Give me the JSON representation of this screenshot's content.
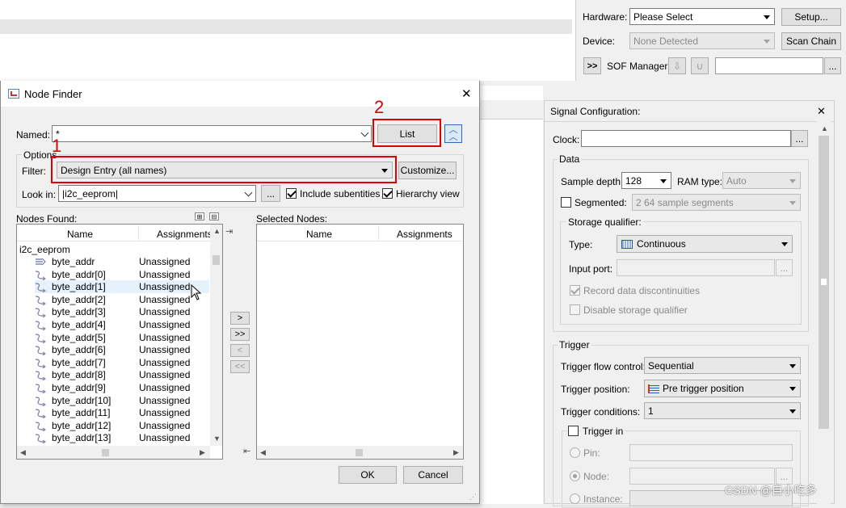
{
  "programmer": {
    "hardware_label": "Hardware:",
    "hardware_value": "Please Select",
    "setup_button": "Setup...",
    "device_label": "Device:",
    "device_value": "None Detected",
    "scan_chain_button": "Scan Chain",
    "expand_button": ">>",
    "sof_manager_label": "SOF Manager:",
    "browse_button": "..."
  },
  "node_finder": {
    "title": "Node Finder",
    "close_glyph": "✕",
    "named_label": "Named:",
    "named_value": "*",
    "list_button": "List",
    "options_label": "Options",
    "filter_label": "Filter:",
    "filter_value": "Design Entry (all names)",
    "customize_button": "Customize...",
    "lookin_label": "Look in:",
    "lookin_value": "|i2c_eeprom|",
    "lookin_browse": "...",
    "include_subentities": "Include subentities",
    "hierarchy_view": "Hierarchy view",
    "nodes_found_label": "Nodes Found:",
    "selected_nodes_label": "Selected Nodes:",
    "col_name": "Name",
    "col_assignments": "Assignments",
    "root_node": "i2c_eeprom",
    "nodes": [
      {
        "name": "byte_addr",
        "assignment": "Unassigned",
        "bus": true
      },
      {
        "name": "byte_addr[0]",
        "assignment": "Unassigned"
      },
      {
        "name": "byte_addr[1]",
        "assignment": "Unassigned",
        "selected": true
      },
      {
        "name": "byte_addr[2]",
        "assignment": "Unassigned"
      },
      {
        "name": "byte_addr[3]",
        "assignment": "Unassigned"
      },
      {
        "name": "byte_addr[4]",
        "assignment": "Unassigned"
      },
      {
        "name": "byte_addr[5]",
        "assignment": "Unassigned"
      },
      {
        "name": "byte_addr[6]",
        "assignment": "Unassigned"
      },
      {
        "name": "byte_addr[7]",
        "assignment": "Unassigned"
      },
      {
        "name": "byte_addr[8]",
        "assignment": "Unassigned"
      },
      {
        "name": "byte_addr[9]",
        "assignment": "Unassigned"
      },
      {
        "name": "byte_addr[10]",
        "assignment": "Unassigned"
      },
      {
        "name": "byte_addr[11]",
        "assignment": "Unassigned"
      },
      {
        "name": "byte_addr[12]",
        "assignment": "Unassigned"
      },
      {
        "name": "byte_addr[13]",
        "assignment": "Unassigned"
      }
    ],
    "move_one": ">",
    "move_all": ">>",
    "remove_one": "<",
    "remove_all": "<<",
    "ok_button": "OK",
    "cancel_button": "Cancel"
  },
  "annotations": {
    "marker_1": "1",
    "marker_2": "2",
    "color": "#e00000"
  },
  "signal_config": {
    "title": "Signal Configuration:",
    "close_glyph": "✕",
    "clock_label": "Clock:",
    "clock_browse": "...",
    "data_group": "Data",
    "sample_depth_label": "Sample depth:",
    "sample_depth_value": "128",
    "ram_type_label": "RAM type:",
    "ram_type_value": "Auto",
    "segmented_label": "Segmented:",
    "segmented_value": "2  64 sample segments",
    "storage_qualifier_group": "Storage qualifier:",
    "type_label": "Type:",
    "type_value": "Continuous",
    "input_port_label": "Input port:",
    "input_port_browse": "...",
    "record_discontinuities": "Record data discontinuities",
    "disable_storage_qualifier": "Disable storage qualifier",
    "trigger_group": "Trigger",
    "trigger_flow_label": "Trigger flow control:",
    "trigger_flow_value": "Sequential",
    "trigger_position_label": "Trigger position:",
    "trigger_position_value": "Pre trigger position",
    "trigger_conditions_label": "Trigger conditions:",
    "trigger_conditions_value": "1",
    "trigger_in_label": "Trigger in",
    "pin_label": "Pin:",
    "node_label": "Node:",
    "node_browse": "...",
    "instance_label": "Instance:"
  },
  "watermark": "CSDN @自小吃多"
}
